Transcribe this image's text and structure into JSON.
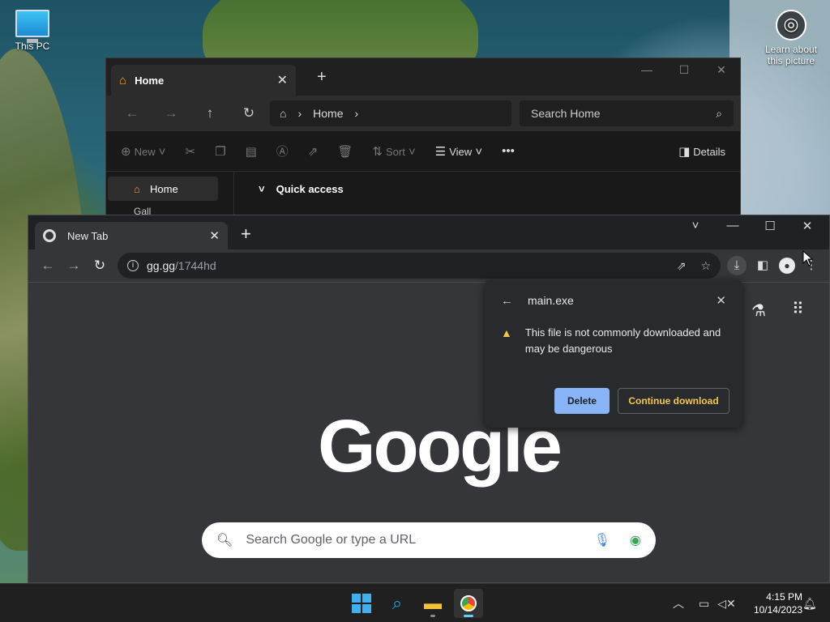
{
  "desktop": {
    "icons": [
      {
        "label": "This PC"
      },
      {
        "label": "Learn about this picture"
      }
    ]
  },
  "explorer": {
    "tab_title": "Home",
    "new_tab": "+",
    "close": "✕",
    "breadcrumb": "Home",
    "search_placeholder": "Search Home",
    "commands": {
      "new": "New",
      "sort": "Sort",
      "view": "View",
      "details": "Details"
    },
    "sidebar": {
      "home": "Home",
      "gallery_partial": "Gall"
    },
    "section": "Quick access"
  },
  "chrome": {
    "tab_title": "New Tab",
    "url_host": "gg.gg",
    "url_path": "/1744hd",
    "logo_text": "Google",
    "search_placeholder": "Search Google or type a URL"
  },
  "download_bubble": {
    "filename": "main.exe",
    "warning": "This file is not commonly downloaded and may be dangerous",
    "delete_label": "Delete",
    "continue_label": "Continue download",
    "accent": "#8ab4f8",
    "warning_color": "#f2c94c"
  },
  "taskbar": {
    "time": "4:15 PM",
    "date": "10/14/2023"
  }
}
